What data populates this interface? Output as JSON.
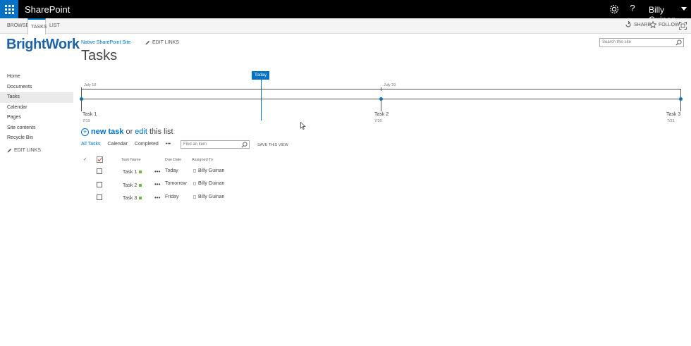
{
  "suitebar": {
    "app_name": "SharePoint",
    "help_glyph": "?",
    "user_name": "Billy Guinan",
    "icons": [
      "app-launcher-icon",
      "gear-icon"
    ]
  },
  "ribbon": {
    "tabs": [
      "BROWSE",
      "TASKS",
      "LIST"
    ],
    "selected_tab": "TASKS",
    "share_label": "SHARE",
    "follow_label": "FOLLOW"
  },
  "logo_text": "BrightWork",
  "leftnav": {
    "items": [
      "Home",
      "Documents",
      "Tasks",
      "Calendar",
      "Pages",
      "Site contents",
      "Recycle Bin"
    ],
    "selected": "Tasks",
    "edit_links": "EDIT LINKS"
  },
  "header": {
    "site_link": "Native SharePoint Site",
    "edit_links": "EDIT LINKS",
    "page_title": "Tasks",
    "search_placeholder": "Search this site"
  },
  "timeline": {
    "today_label": "Today",
    "dates": [
      "July 19",
      "July 20"
    ],
    "milestones": [
      {
        "name": "Task 1",
        "date": "7/19"
      },
      {
        "name": "Task 2",
        "date": "7/20"
      },
      {
        "name": "Task 3",
        "date": "7/21"
      }
    ]
  },
  "newtask": {
    "plus": "+",
    "new_task": "new task",
    "or": "or",
    "edit": "edit",
    "this_list": "this list"
  },
  "views": {
    "items": [
      "All Tasks",
      "Calendar",
      "Completed"
    ],
    "selected": "All Tasks",
    "more": "•••",
    "find_placeholder": "Find an item",
    "save_view": "SAVE THIS VIEW"
  },
  "list": {
    "check_header": "✓",
    "columns": [
      "Task Name",
      "Due Date",
      "Assigned To"
    ],
    "rows": [
      {
        "task": "Task 1",
        "due": "Today",
        "assigned": "Billy Guinan"
      },
      {
        "task": "Task 2",
        "due": "Tomorrow",
        "assigned": "Billy Guinan"
      },
      {
        "task": "Task 3",
        "due": "Friday",
        "assigned": "Billy Guinan"
      }
    ],
    "ellipsis": "•••"
  }
}
